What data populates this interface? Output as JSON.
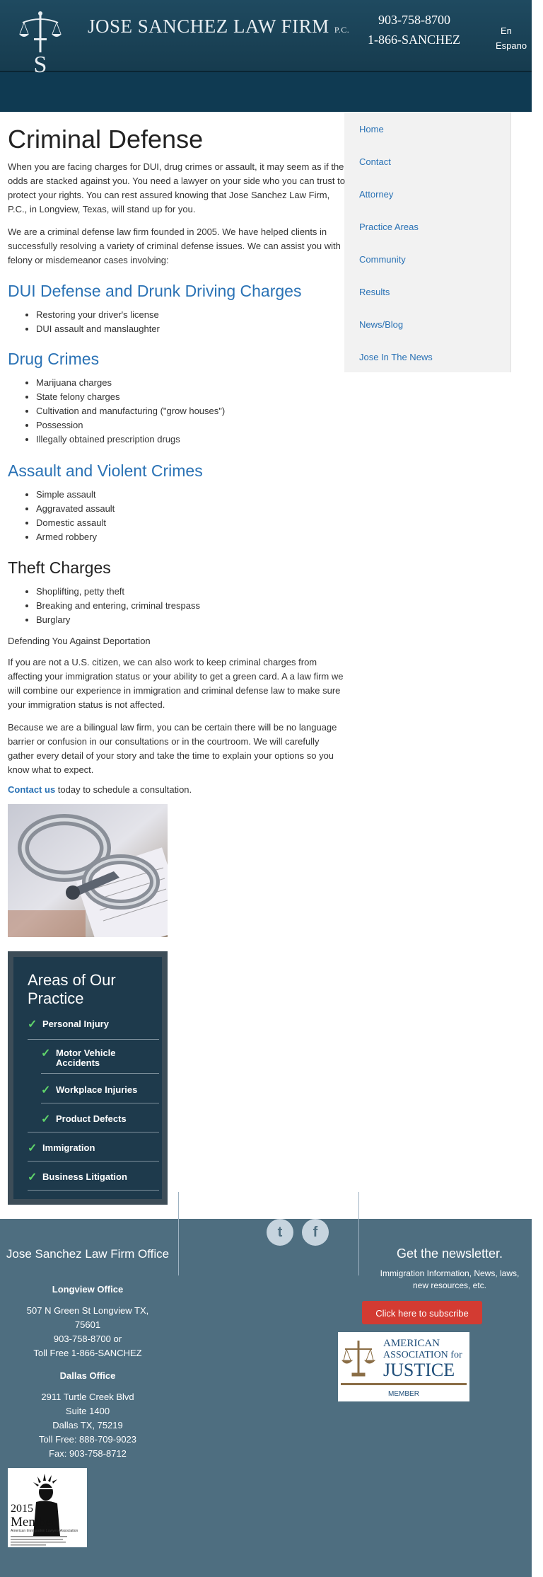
{
  "header": {
    "firm_name": "JOSE SANCHEZ LAW FIRM",
    "firm_suffix": "P.C.",
    "phone_local": "903-758-8700",
    "phone_tollfree": "1-866-SANCHEZ",
    "lang_en": "En",
    "lang_es": "Espano"
  },
  "nav": {
    "items": [
      {
        "label": "Home"
      },
      {
        "label": "Contact"
      },
      {
        "label": "Attorney"
      },
      {
        "label": "Practice Areas"
      },
      {
        "label": "Community"
      },
      {
        "label": "Results"
      },
      {
        "label": "News/Blog"
      },
      {
        "label": "Jose In The News"
      }
    ]
  },
  "main": {
    "title": "Criminal Defense",
    "intro": "When you are facing charges for DUI, drug crimes or assault, it may seem as if the odds are stacked against you. You need a lawyer on your side who you can trust to protect your rights. You can rest assured knowing that Jose Sanchez Law Firm, P.C., in Longview, Texas, will stand up for you.",
    "intro2": "We are a criminal defense law firm founded in 2005. We have helped clients in successfully resolving a variety of criminal defense issues. We can assist you with felony or misdemeanor cases involving:",
    "sections": [
      {
        "heading": "DUI Defense and Drunk Driving Charges",
        "items": [
          "Restoring your driver's license",
          "DUI assault and manslaughter"
        ]
      },
      {
        "heading": "Drug Crimes",
        "items": [
          "Marijuana charges",
          "State felony charges",
          "Cultivation and manufacturing (\"grow houses\")",
          "Possession",
          "Illegally obtained prescription drugs"
        ]
      },
      {
        "heading": "Assault and Violent Crimes",
        "items": [
          "Simple assault",
          "Aggravated assault",
          "Domestic assault",
          "Armed robbery"
        ]
      },
      {
        "heading": "Theft Charges",
        "items": [
          "Shoplifting, petty theft",
          "Breaking and entering, criminal trespass",
          "Burglary"
        ]
      }
    ],
    "deport_head": "Defending You Against Deportation",
    "deport_p1": "If you are not a U.S. citizen, we can also work to keep criminal charges from affecting your immigration status or your ability to get a green card. A a law firm we will combine our experience in immigration and criminal defense law to make sure your immigration status is not affected.",
    "deport_p2": "Because we are a bilingual law firm, you can be certain there will be no language barrier or confusion in our consultations or in the courtroom. We will carefully gather every detail of your story and take the time to explain your options so you know what to expect.",
    "contact_link": "Contact us",
    "contact_rest": " today to schedule a consultation."
  },
  "areas": {
    "title": "Areas of Our Practice",
    "items": [
      {
        "label": "Personal Injury"
      },
      {
        "label": "Motor Vehicle Accidents"
      },
      {
        "label": "Workplace Injuries"
      },
      {
        "label": "Product Defects"
      },
      {
        "label": "Immigration"
      },
      {
        "label": "Business Litigation"
      }
    ]
  },
  "footer": {
    "office_title": "Jose Sanchez Law Firm Office",
    "longview_head": "Longview Office",
    "longview_addr1": "507 N Green St Longview TX,",
    "longview_addr2": "75601",
    "longview_phone": "903-758-8700 or",
    "longview_toll": "Toll Free 1-866-SANCHEZ",
    "dallas_head": "Dallas Office",
    "dallas_addr1": "2911 Turtle Creek Blvd",
    "dallas_addr2": "Suite 1400",
    "dallas_addr3": "Dallas TX, 75219",
    "dallas_toll": "Toll Free: 888-709-9023",
    "dallas_fax": "Fax: 903-758-8712",
    "newsletter_title": "Get the newsletter.",
    "newsletter_sub": "Immigration Information, News, laws, new resources, etc.",
    "subscribe_label": "Click here to subscribe",
    "aaj_line1": "AMERICAN",
    "aaj_line2": "ASSOCIATION for",
    "aaj_line3": "JUSTICE",
    "aaj_line4": "MEMBER",
    "badge_year": "2015",
    "badge_member": "Member",
    "badge_org": "American Immigration Lawyers Association"
  }
}
